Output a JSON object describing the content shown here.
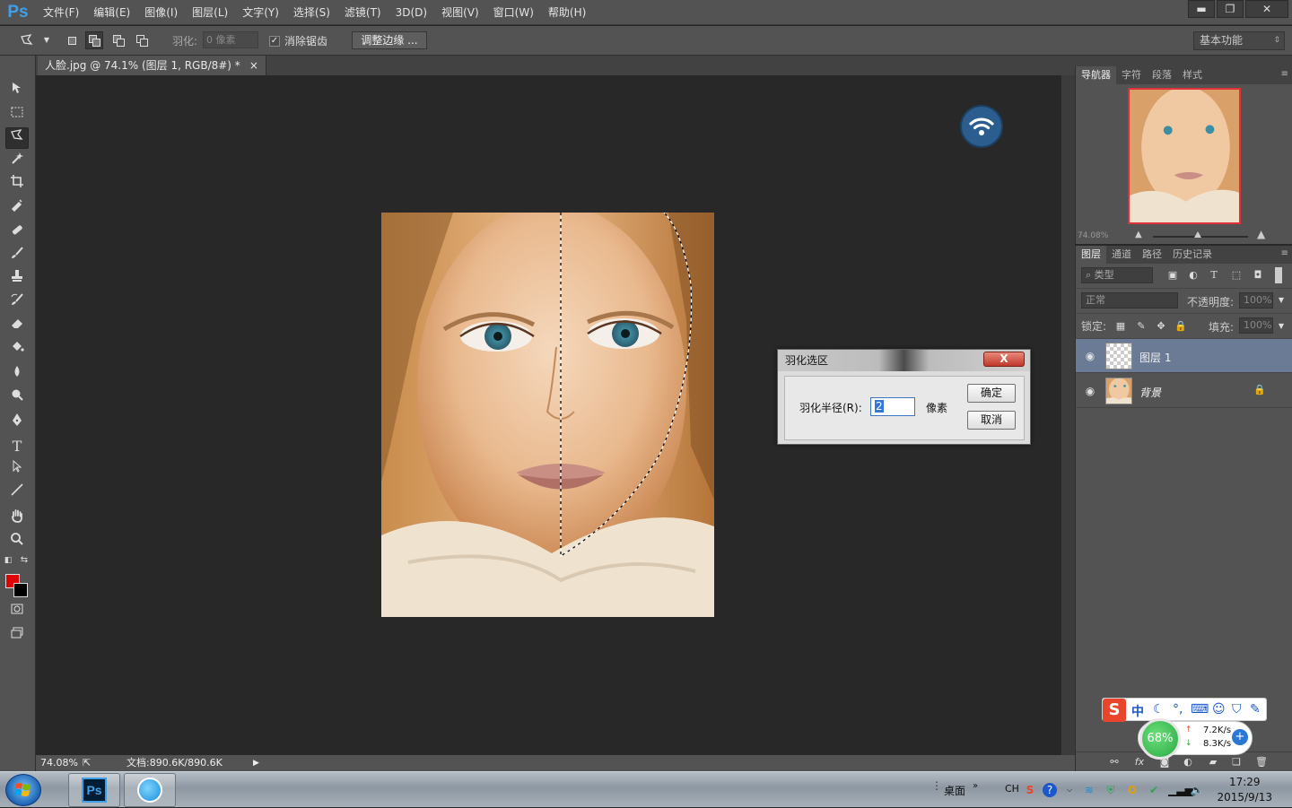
{
  "app": {
    "logo": "Ps"
  },
  "menu": [
    "文件(F)",
    "编辑(E)",
    "图像(I)",
    "图层(L)",
    "文字(Y)",
    "选择(S)",
    "滤镜(T)",
    "3D(D)",
    "视图(V)",
    "窗口(W)",
    "帮助(H)"
  ],
  "window_controls": {
    "minimize": "▬",
    "restore": "❐",
    "close": "✕"
  },
  "options": {
    "feather_label": "羽化:",
    "feather_value": "0 像素",
    "antialias_label": "消除锯齿",
    "antialias_checked": true,
    "refine_edge_label": "调整边缘 ...",
    "workspace": "基本功能"
  },
  "document": {
    "tab_title": "人脸.jpg @ 74.1% (图层 1, RGB/8#) *",
    "tab_close": "×",
    "status_zoom": "74.08%",
    "status_doc": "文档:890.6K/890.6K"
  },
  "colors": {
    "foreground": "#e00000",
    "background": "#000000",
    "accent": "#3fa0e8"
  },
  "dialog": {
    "title": "羽化选区",
    "close": "X",
    "radius_label": "羽化半径(R):",
    "radius_value": "2",
    "unit": "像素",
    "ok": "确定",
    "cancel": "取消"
  },
  "navigator": {
    "tabs": [
      "导航器",
      "字符",
      "段落",
      "样式"
    ],
    "zoom": "74.08%"
  },
  "layers": {
    "tabs": [
      "图层",
      "通道",
      "路径",
      "历史记录"
    ],
    "kind_filter": "类型",
    "blend_mode": "正常",
    "opacity_label": "不透明度:",
    "opacity_value": "100%",
    "lock_label": "锁定:",
    "fill_label": "填充:",
    "fill_value": "100%",
    "items": [
      {
        "name": "图层 1",
        "selected": true
      },
      {
        "name": "背景",
        "selected": false,
        "locked": true
      }
    ]
  },
  "ime": {
    "logo": "S",
    "mode": "中"
  },
  "network": {
    "percent": "68%",
    "up": "7.2K/s",
    "down": "8.3K/s"
  },
  "taskbar": {
    "desktop_label": "桌面",
    "lang": "CH",
    "time": "17:29",
    "date": "2015/9/13"
  }
}
